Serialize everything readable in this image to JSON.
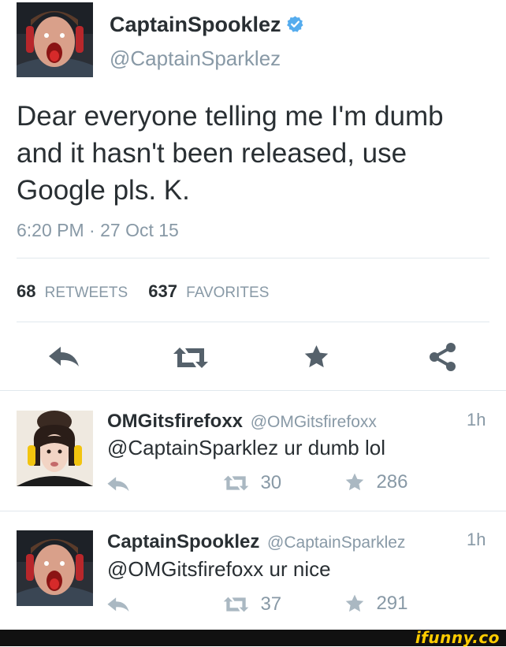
{
  "main_tweet": {
    "display_name": "CaptainSpooklez",
    "handle": "@CaptainSparklez",
    "text_line1": "Dear everyone telling me I'm dumb",
    "text_line2": "and it hasn't been released, use",
    "text_line3": "Google pls. K.",
    "timestamp": "6:20 PM · 27 Oct 15",
    "retweets_count": "68",
    "retweets_label": "RETWEETS",
    "favorites_count": "637",
    "favorites_label": "FAVORITES",
    "actions": [
      "reply-icon",
      "retweet-icon",
      "favorite-icon",
      "share-icon"
    ]
  },
  "replies": [
    {
      "display_name": "OMGitsfirefoxx",
      "handle": "@OMGitsfirefoxx",
      "time": "1h",
      "text": "@CaptainSparklez ur dumb lol",
      "retweets": "30",
      "favorites": "286"
    },
    {
      "display_name": "CaptainSpooklez",
      "handle": "@CaptainSparklez",
      "time": "1h",
      "text": "@OMGitsfirefoxx ur nice",
      "retweets": "37",
      "favorites": "291"
    }
  ],
  "watermark": "ifunny.co",
  "colors": {
    "icon_dark": "#55616b",
    "icon_light": "#aab8c2",
    "verified": "#55acee",
    "divider": "#e1e8ed",
    "footer_bar": "#111111",
    "watermark": "#ffcc00"
  }
}
